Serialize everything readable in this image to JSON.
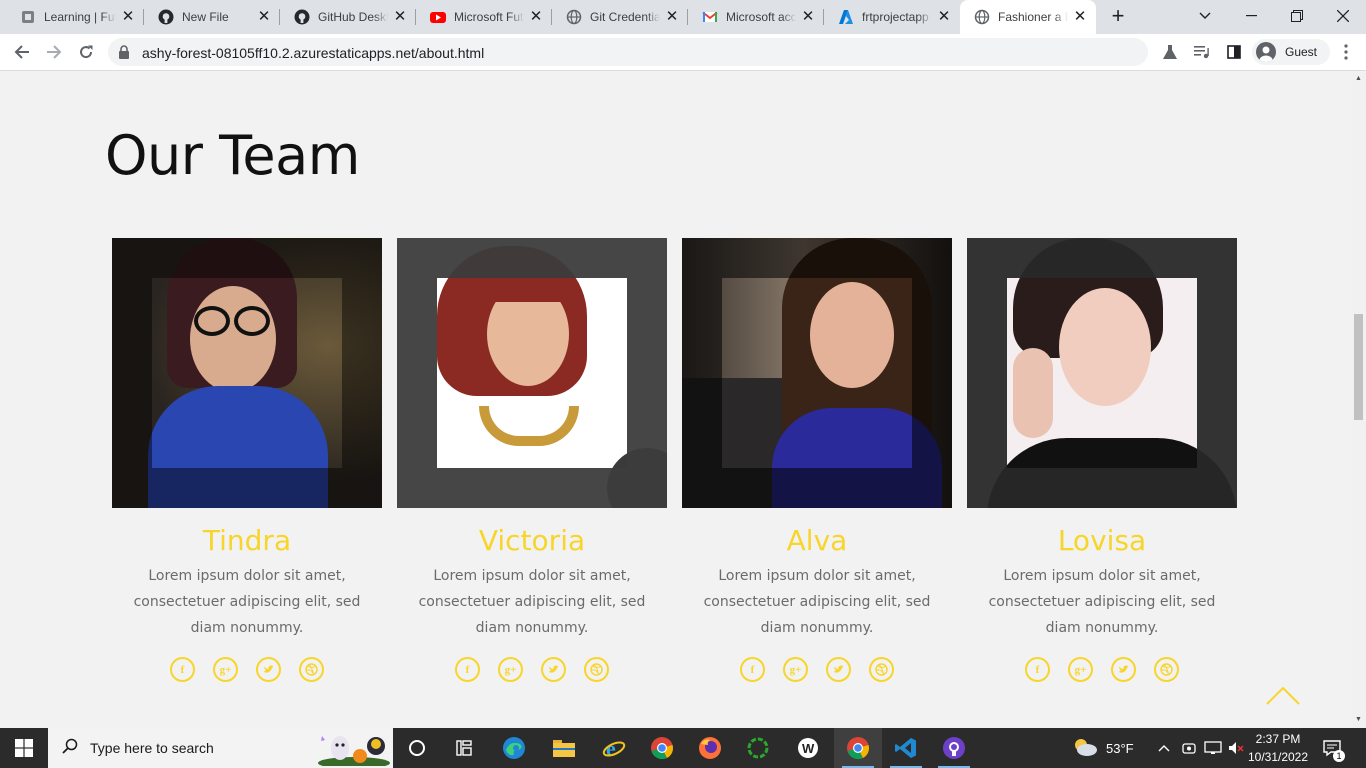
{
  "browser": {
    "tabs": [
      {
        "title": "Learning | Future",
        "icon": "learning-favicon",
        "active": false
      },
      {
        "title": "New File",
        "icon": "github-favicon",
        "active": false
      },
      {
        "title": "GitHub Desktop",
        "icon": "github-favicon",
        "active": false
      },
      {
        "title": "Microsoft Future",
        "icon": "youtube-favicon",
        "active": false
      },
      {
        "title": "Git Credential",
        "icon": "globe-favicon",
        "active": false
      },
      {
        "title": "Microsoft account",
        "icon": "gmail-favicon",
        "active": false
      },
      {
        "title": "frtprojectapp",
        "icon": "azure-favicon",
        "active": false
      },
      {
        "title": "Fashioner a Fashion",
        "icon": "globe-favicon",
        "active": true
      }
    ],
    "url": "ashy-forest-08105ff10.2.azurestaticapps.net/about.html",
    "profile_label": "Guest"
  },
  "page": {
    "heading": "Our Team",
    "team": [
      {
        "name": "Tindra",
        "description": "Lorem ipsum dolor sit amet, consectetuer adipiscing elit, sed diam nonummy."
      },
      {
        "name": "Victoria",
        "description": "Lorem ipsum dolor sit amet, consectetuer adipiscing elit, sed diam nonummy."
      },
      {
        "name": "Alva",
        "description": "Lorem ipsum dolor sit amet, consectetuer adipiscing elit, sed diam nonummy."
      },
      {
        "name": "Lovisa",
        "description": "Lorem ipsum dolor sit amet, consectetuer adipiscing elit, sed diam nonummy."
      }
    ],
    "social_icons": [
      "facebook-icon",
      "google-plus-icon",
      "twitter-icon",
      "dribbble-icon"
    ],
    "accent_color": "#f7d52a"
  },
  "taskbar": {
    "search_placeholder": "Type here to search",
    "weather": "53°F",
    "time": "2:37 PM",
    "date": "10/31/2022",
    "notification_count": "1"
  }
}
